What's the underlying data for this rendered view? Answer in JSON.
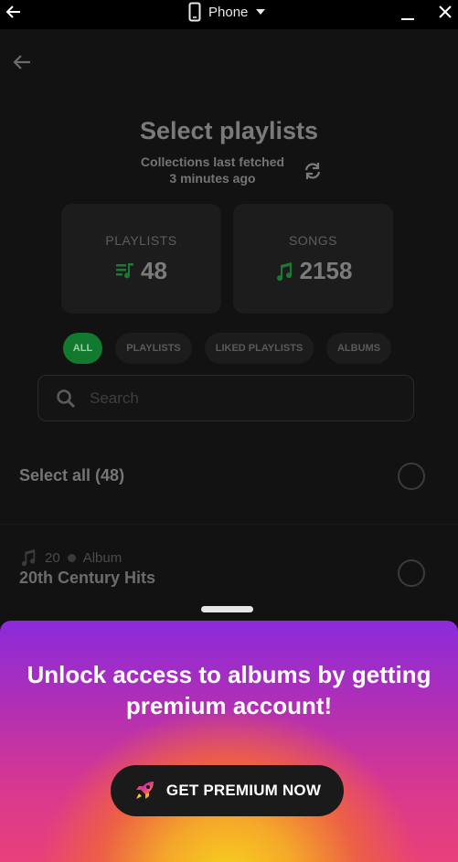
{
  "titlebar": {
    "device_label": "Phone",
    "icons": [
      "back-arrow-icon",
      "phone-icon",
      "caret-down-icon",
      "minimize-icon",
      "close-icon"
    ]
  },
  "header": {
    "title": "Select playlists",
    "fetched_line1": "Collections last fetched",
    "fetched_line2": "3 minutes ago"
  },
  "stats": {
    "playlists_label": "PLAYLISTS",
    "playlists_value": "48",
    "songs_label": "SONGS",
    "songs_value": "2158"
  },
  "filters": {
    "chips": [
      "ALL",
      "PLAYLISTS",
      "LIKED PLAYLISTS",
      "ALBUMS"
    ],
    "active": "ALL"
  },
  "search": {
    "placeholder": "Search",
    "value": ""
  },
  "list": {
    "select_all_label": "Select all (48)",
    "items": [
      {
        "count": "20",
        "type": "Album",
        "title": "20th Century Hits"
      }
    ]
  },
  "premium_sheet": {
    "message": "Unlock access to albums by getting premium account!",
    "button_label": "GET PREMIUM NOW"
  },
  "colors": {
    "accent_green": "#127a2e",
    "sheet_purple": "#8b2bdb",
    "sheet_pink": "#e9407a",
    "sheet_yellow": "#f7d21e"
  }
}
